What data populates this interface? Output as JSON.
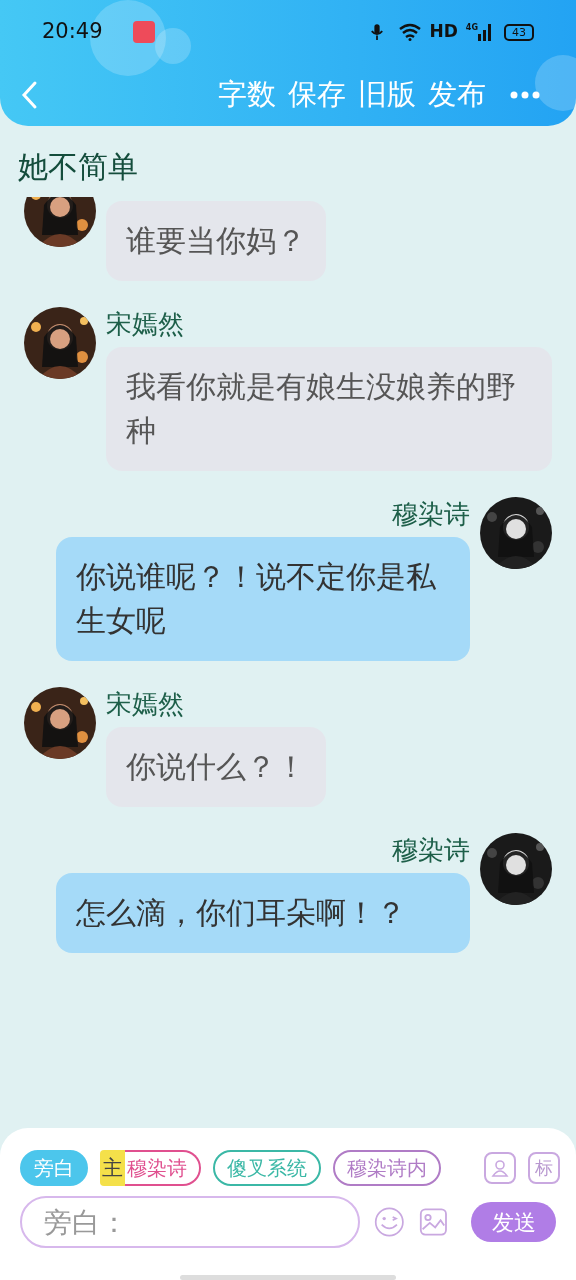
{
  "status_bar": {
    "time": "20:49",
    "network": "HD",
    "cell": "4G",
    "battery": "43"
  },
  "header": {
    "actions": [
      "字数",
      "保存",
      "旧版",
      "发布"
    ]
  },
  "story_title": "她不简单",
  "messages": [
    {
      "kind": "left",
      "text": "谁要当你妈？"
    },
    {
      "kind": "left",
      "name": "宋嫣然",
      "text": "我看你就是有娘生没娘养的野种"
    },
    {
      "kind": "right",
      "name": "穆染诗",
      "text": "你说谁呢？！说不定你是私生女呢"
    },
    {
      "kind": "left",
      "name": "宋嫣然",
      "text": "你说什么？！"
    },
    {
      "kind": "right",
      "name": "穆染诗",
      "text": "怎么滴，你们耳朵啊！？"
    }
  ],
  "composer": {
    "roles": [
      {
        "label": "旁白",
        "selected": true,
        "color": "#4cc6ec"
      },
      {
        "label": "穆染诗",
        "selected": false,
        "color": "#e0508f",
        "tag": "主"
      },
      {
        "label": "傻叉系统",
        "selected": false,
        "color": "#3bb8a6"
      },
      {
        "label": "穆染诗内",
        "selected": false,
        "color": "#b07cc6"
      }
    ],
    "mark_button": "标",
    "placeholder": "旁白：",
    "send": "发送"
  }
}
